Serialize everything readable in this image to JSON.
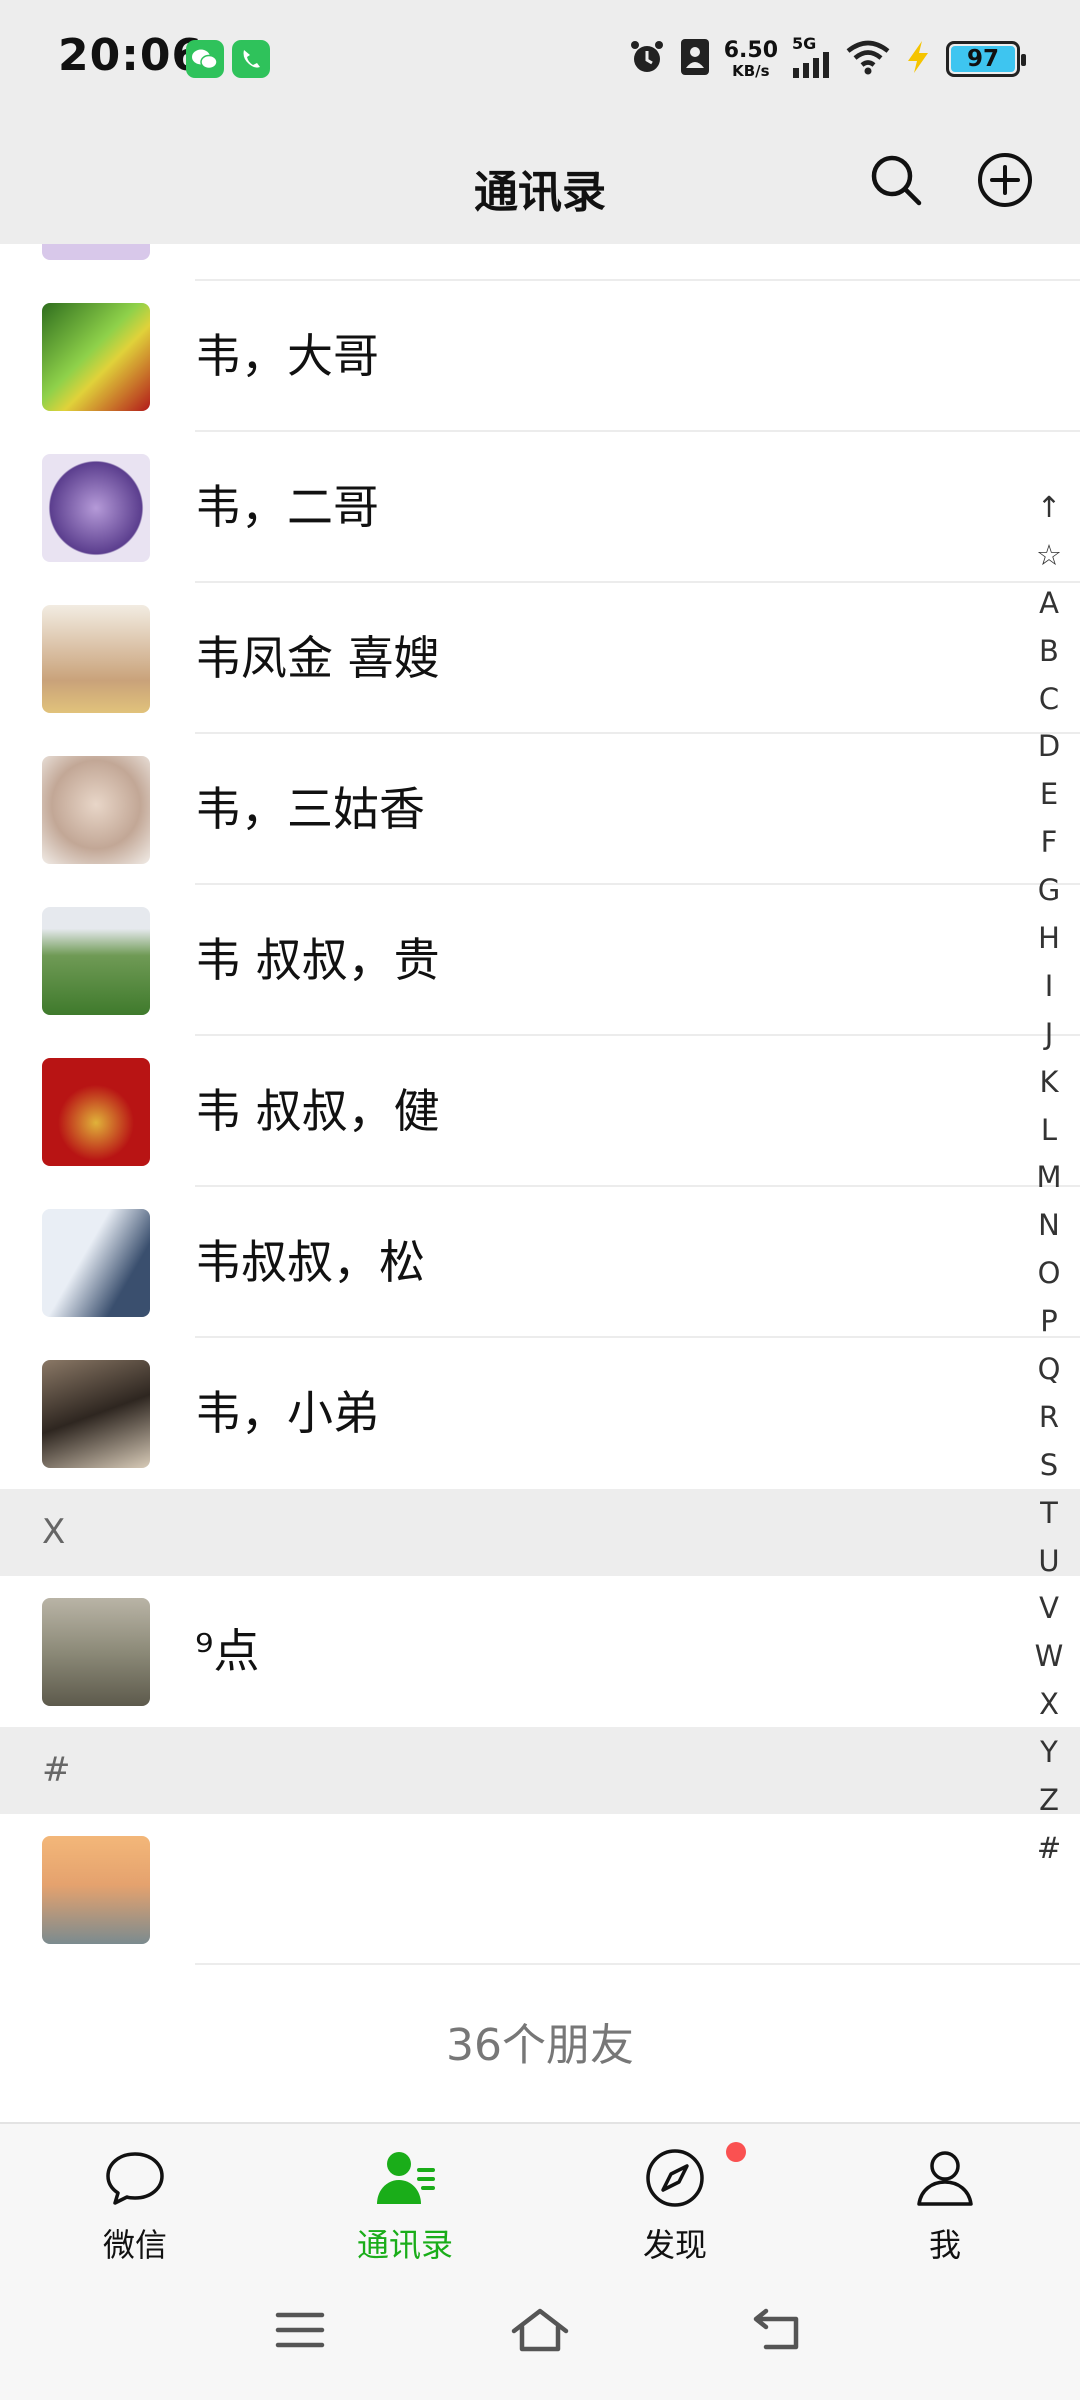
{
  "status_bar": {
    "time": "20:06",
    "net_speed_value": "6.50",
    "net_speed_unit": "KB/s",
    "network_type": "5G",
    "battery_level": "97",
    "icons": [
      "wechat-icon",
      "phone-app-icon",
      "alarm-icon",
      "contact-card-icon",
      "signal-icon",
      "wifi-icon",
      "charging-icon",
      "battery-icon"
    ]
  },
  "header": {
    "title": "通讯录",
    "actions": [
      "search-icon",
      "add-icon"
    ]
  },
  "contacts": [
    {
      "name": "",
      "avatar_color": "#d8c8ea"
    },
    {
      "name": "韦，大哥",
      "avatar_color": "#3b8a2a"
    },
    {
      "name": "韦，二哥",
      "avatar_color": "#7b5aa6"
    },
    {
      "name": "韦凤金 喜嫂",
      "avatar_color": "#c9a27a"
    },
    {
      "name": "韦，三姑香",
      "avatar_color": "#cfb7a5"
    },
    {
      "name": "韦 叔叔，贵",
      "avatar_color": "#5e8f45"
    },
    {
      "name": "韦 叔叔，健",
      "avatar_color": "#b81414"
    },
    {
      "name": "韦叔叔，松",
      "avatar_color": "#3a4f6e"
    },
    {
      "name": "韦，小弟",
      "avatar_color": "#5a4a3c"
    }
  ],
  "sections": [
    {
      "letter": "X",
      "contacts": [
        {
          "name": "⁹点",
          "avatar_color": "#8c8a78"
        }
      ]
    },
    {
      "letter": "#",
      "contacts": [
        {
          "name": "",
          "avatar_color": "#e5a26e"
        }
      ]
    }
  ],
  "friend_count": "36个朋友",
  "alphabet_index": [
    "↑",
    "☆",
    "A",
    "B",
    "C",
    "D",
    "E",
    "F",
    "G",
    "H",
    "I",
    "J",
    "K",
    "L",
    "M",
    "N",
    "O",
    "P",
    "Q",
    "R",
    "S",
    "T",
    "U",
    "V",
    "W",
    "X",
    "Y",
    "Z",
    "#"
  ],
  "tabs": [
    {
      "label": "微信",
      "icon": "chat-bubble-icon",
      "active": false
    },
    {
      "label": "通讯录",
      "icon": "contacts-icon",
      "active": true
    },
    {
      "label": "发现",
      "icon": "compass-icon",
      "active": false,
      "badge": "dot"
    },
    {
      "label": "我",
      "icon": "person-icon",
      "active": false
    }
  ],
  "nav_bar": [
    "menu-icon",
    "home-icon",
    "back-icon"
  ],
  "colors": {
    "accent": "#1aad19",
    "header_bg": "#ededed",
    "badge": "#fa5151"
  }
}
